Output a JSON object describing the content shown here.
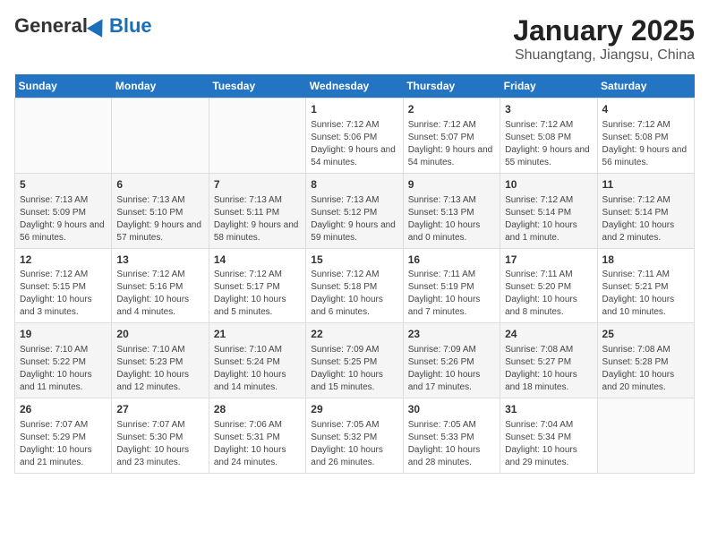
{
  "logo": {
    "general": "General",
    "blue": "Blue"
  },
  "title": {
    "month": "January 2025",
    "location": "Shuangtang, Jiangsu, China"
  },
  "headers": [
    "Sunday",
    "Monday",
    "Tuesday",
    "Wednesday",
    "Thursday",
    "Friday",
    "Saturday"
  ],
  "weeks": [
    [
      {
        "day": "",
        "info": ""
      },
      {
        "day": "",
        "info": ""
      },
      {
        "day": "",
        "info": ""
      },
      {
        "day": "1",
        "info": "Sunrise: 7:12 AM\nSunset: 5:06 PM\nDaylight: 9 hours and 54 minutes."
      },
      {
        "day": "2",
        "info": "Sunrise: 7:12 AM\nSunset: 5:07 PM\nDaylight: 9 hours and 54 minutes."
      },
      {
        "day": "3",
        "info": "Sunrise: 7:12 AM\nSunset: 5:08 PM\nDaylight: 9 hours and 55 minutes."
      },
      {
        "day": "4",
        "info": "Sunrise: 7:12 AM\nSunset: 5:08 PM\nDaylight: 9 hours and 56 minutes."
      }
    ],
    [
      {
        "day": "5",
        "info": "Sunrise: 7:13 AM\nSunset: 5:09 PM\nDaylight: 9 hours and 56 minutes."
      },
      {
        "day": "6",
        "info": "Sunrise: 7:13 AM\nSunset: 5:10 PM\nDaylight: 9 hours and 57 minutes."
      },
      {
        "day": "7",
        "info": "Sunrise: 7:13 AM\nSunset: 5:11 PM\nDaylight: 9 hours and 58 minutes."
      },
      {
        "day": "8",
        "info": "Sunrise: 7:13 AM\nSunset: 5:12 PM\nDaylight: 9 hours and 59 minutes."
      },
      {
        "day": "9",
        "info": "Sunrise: 7:13 AM\nSunset: 5:13 PM\nDaylight: 10 hours and 0 minutes."
      },
      {
        "day": "10",
        "info": "Sunrise: 7:12 AM\nSunset: 5:14 PM\nDaylight: 10 hours and 1 minute."
      },
      {
        "day": "11",
        "info": "Sunrise: 7:12 AM\nSunset: 5:14 PM\nDaylight: 10 hours and 2 minutes."
      }
    ],
    [
      {
        "day": "12",
        "info": "Sunrise: 7:12 AM\nSunset: 5:15 PM\nDaylight: 10 hours and 3 minutes."
      },
      {
        "day": "13",
        "info": "Sunrise: 7:12 AM\nSunset: 5:16 PM\nDaylight: 10 hours and 4 minutes."
      },
      {
        "day": "14",
        "info": "Sunrise: 7:12 AM\nSunset: 5:17 PM\nDaylight: 10 hours and 5 minutes."
      },
      {
        "day": "15",
        "info": "Sunrise: 7:12 AM\nSunset: 5:18 PM\nDaylight: 10 hours and 6 minutes."
      },
      {
        "day": "16",
        "info": "Sunrise: 7:11 AM\nSunset: 5:19 PM\nDaylight: 10 hours and 7 minutes."
      },
      {
        "day": "17",
        "info": "Sunrise: 7:11 AM\nSunset: 5:20 PM\nDaylight: 10 hours and 8 minutes."
      },
      {
        "day": "18",
        "info": "Sunrise: 7:11 AM\nSunset: 5:21 PM\nDaylight: 10 hours and 10 minutes."
      }
    ],
    [
      {
        "day": "19",
        "info": "Sunrise: 7:10 AM\nSunset: 5:22 PM\nDaylight: 10 hours and 11 minutes."
      },
      {
        "day": "20",
        "info": "Sunrise: 7:10 AM\nSunset: 5:23 PM\nDaylight: 10 hours and 12 minutes."
      },
      {
        "day": "21",
        "info": "Sunrise: 7:10 AM\nSunset: 5:24 PM\nDaylight: 10 hours and 14 minutes."
      },
      {
        "day": "22",
        "info": "Sunrise: 7:09 AM\nSunset: 5:25 PM\nDaylight: 10 hours and 15 minutes."
      },
      {
        "day": "23",
        "info": "Sunrise: 7:09 AM\nSunset: 5:26 PM\nDaylight: 10 hours and 17 minutes."
      },
      {
        "day": "24",
        "info": "Sunrise: 7:08 AM\nSunset: 5:27 PM\nDaylight: 10 hours and 18 minutes."
      },
      {
        "day": "25",
        "info": "Sunrise: 7:08 AM\nSunset: 5:28 PM\nDaylight: 10 hours and 20 minutes."
      }
    ],
    [
      {
        "day": "26",
        "info": "Sunrise: 7:07 AM\nSunset: 5:29 PM\nDaylight: 10 hours and 21 minutes."
      },
      {
        "day": "27",
        "info": "Sunrise: 7:07 AM\nSunset: 5:30 PM\nDaylight: 10 hours and 23 minutes."
      },
      {
        "day": "28",
        "info": "Sunrise: 7:06 AM\nSunset: 5:31 PM\nDaylight: 10 hours and 24 minutes."
      },
      {
        "day": "29",
        "info": "Sunrise: 7:05 AM\nSunset: 5:32 PM\nDaylight: 10 hours and 26 minutes."
      },
      {
        "day": "30",
        "info": "Sunrise: 7:05 AM\nSunset: 5:33 PM\nDaylight: 10 hours and 28 minutes."
      },
      {
        "day": "31",
        "info": "Sunrise: 7:04 AM\nSunset: 5:34 PM\nDaylight: 10 hours and 29 minutes."
      },
      {
        "day": "",
        "info": ""
      }
    ]
  ]
}
